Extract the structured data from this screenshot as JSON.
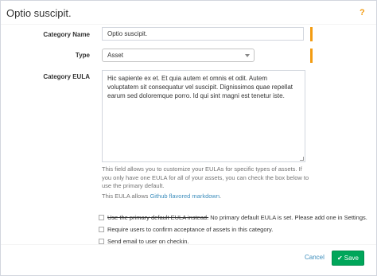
{
  "header": {
    "title": "Optio suscipit.",
    "help_label": "?",
    "help_icon": "question-mark-icon"
  },
  "form": {
    "category_name": {
      "label": "Category Name",
      "value": "Optio suscipit."
    },
    "type": {
      "label": "Type",
      "selected": "Asset"
    },
    "eula": {
      "label": "Category EULA",
      "value": "Hic sapiente ex et. Et quia autem et omnis et odit. Autem voluptatem sit consequatur vel suscipit. Dignissimos quae repellat earum sed doloremque porro. Id qui sint magni est tenetur iste.",
      "help_text": "This field allows you to customize your EULAs for specific types of assets. If you only have one EULA for all of your assets, you can check the box below to use the primary default.",
      "markdown_prefix": "This EULA allows ",
      "markdown_link": "Github flavored markdown",
      "markdown_suffix": "."
    },
    "checkboxes": {
      "use_default_label": "Use the primary default EULA instead.",
      "no_default_note": " No primary default EULA is set. Please add one in Settings.",
      "require_acceptance_label": "Require users to confirm acceptance of assets in this category.",
      "send_email_label": "Send email to user on checkin."
    }
  },
  "footer": {
    "cancel_label": "Cancel",
    "save_label": "Save",
    "save_icon": "checkmark-icon"
  },
  "colors": {
    "required_indicator": "#f39c12",
    "save_button": "#00a65a",
    "link": "#3c8dbc"
  }
}
